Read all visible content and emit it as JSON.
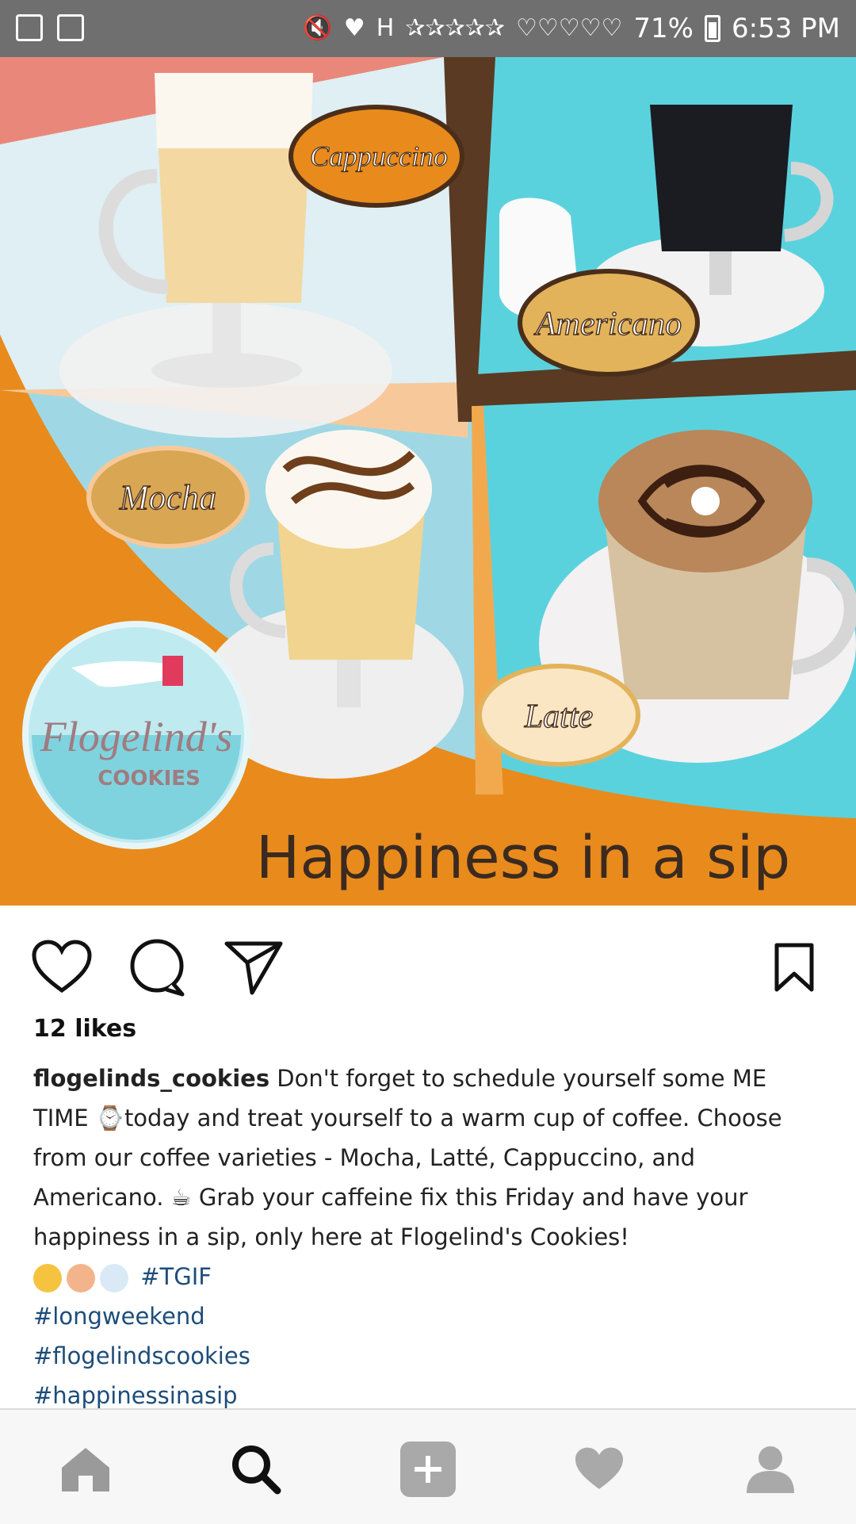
{
  "status_bar": {
    "battery": "71%",
    "time": "6:53 PM",
    "icons": [
      "image-icon",
      "recycle-icon",
      "mute-icon",
      "notification-icon",
      "signal-h-icon",
      "rating-icon",
      "hearts-icon",
      "wifi-icon",
      "battery-icon"
    ]
  },
  "post_image": {
    "labels": {
      "cappuccino": "Cappuccino",
      "americano": "Americano",
      "mocha": "Mocha",
      "latte": "Latte"
    },
    "logo": {
      "name": "Flogelind's",
      "sub": "COOKIES"
    },
    "tagline": "Happiness in a sip",
    "colors": {
      "orange": "#e88b1c",
      "teal": "#6fd0dc",
      "brown": "#5a3a22",
      "peach": "#f7c99a"
    }
  },
  "actions": {
    "icons": [
      "heart-icon",
      "comment-icon",
      "share-icon",
      "bookmark-icon"
    ]
  },
  "post": {
    "likes": "12 likes",
    "username": "flogelinds_cookies",
    "caption_text": " Don't forget to schedule yourself some ME TIME ⌚today and treat yourself to a warm cup of coffee. Choose from our coffee varieties - Mocha, Latté, Cappuccino, and Americano. ☕ Grab your caffeine fix this Friday and have your happiness in a sip, only here at Flogelind's Cookies!",
    "hashtags": [
      "#TGIF",
      "#longweekend",
      "#flogelindscookies",
      "#happinessinasip"
    ]
  },
  "nav": {
    "items": [
      "home-icon",
      "search-icon",
      "add-icon",
      "activity-icon",
      "profile-icon"
    ],
    "active": "search-icon"
  }
}
